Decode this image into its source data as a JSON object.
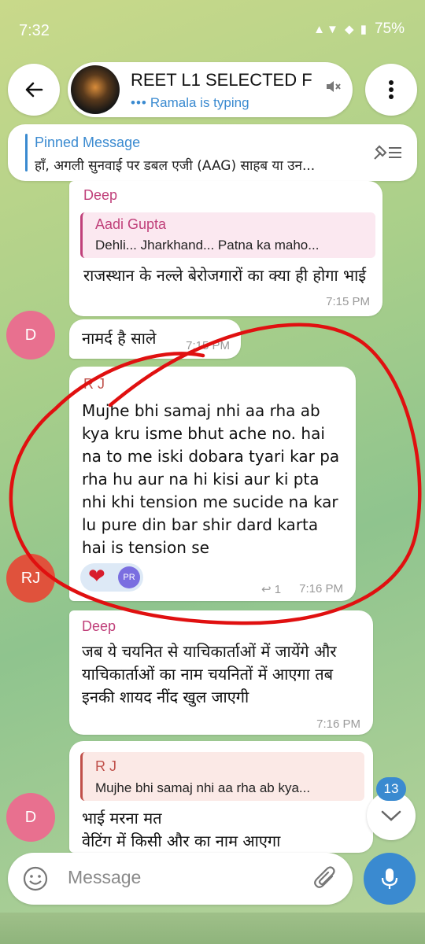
{
  "status_bar": {
    "time": "7:32",
    "icons": "▲▼ ◆ ▮",
    "battery": "75%"
  },
  "header": {
    "title": "REET L1 SELECTED F",
    "typing": "Ramala is typing",
    "typing_dots": "•••"
  },
  "pinned": {
    "title": "Pinned Message",
    "text": "हाँ, अगली सुनवाई पर डबल एजी (AAG) साहब या उन..."
  },
  "messages": [
    {
      "sender": "Deep",
      "reply_name": "Aadi Gupta",
      "reply_text": "Dehli... Jharkhand... Patna ka maho...",
      "text": "राजस्थान के नल्ले बेरोजगारों का क्या ही होगा भाई",
      "time": "7:15 PM"
    },
    {
      "avatar": "D",
      "text": "नामर्द है साले",
      "time": "7:15 PM"
    },
    {
      "sender": "R J",
      "avatar": "RJ",
      "text": "Mujhe bhi samaj nhi aa rha ab kya kru isme bhut ache no. hai na to me iski dobara tyari kar pa rha hu aur na hi kisi aur ki pta nhi khi tension me sucide na kar lu pure din bar shir dard karta hai is tension se",
      "reaction_heart": "❤",
      "reaction_user": "PR",
      "reply_count": "↩ 1",
      "time": "7:16 PM"
    },
    {
      "sender": "Deep",
      "text": "जब ये चयनित से याचिकार्ताओं में जायेंगे और याचिकार्ताओं का नाम चयनितों में आएगा तब इनकी शायद नींद खुल जाएगी",
      "time": "7:16 PM"
    },
    {
      "avatar": "D",
      "reply_name": "R J",
      "reply_text": "Mujhe bhi samaj nhi aa rha ab kya...",
      "text": "भाई मरना मत\nवेटिंग में किसी और का नाम आएगा"
    }
  ],
  "scroll": {
    "unread": "13"
  },
  "input": {
    "placeholder": "Message"
  },
  "colors": {
    "accent": "#3a8ad0",
    "deep": "#c0407a",
    "rj": "#c0504a",
    "avatar_d": "#e8708f",
    "avatar_rj": "#e0523c",
    "annotation": "#e01010"
  },
  "icons": [
    "back-arrow-icon",
    "more-vertical-icon",
    "mute-icon",
    "unpin-list-icon",
    "emoji-icon",
    "attach-icon",
    "mic-icon",
    "chevron-down-icon"
  ]
}
